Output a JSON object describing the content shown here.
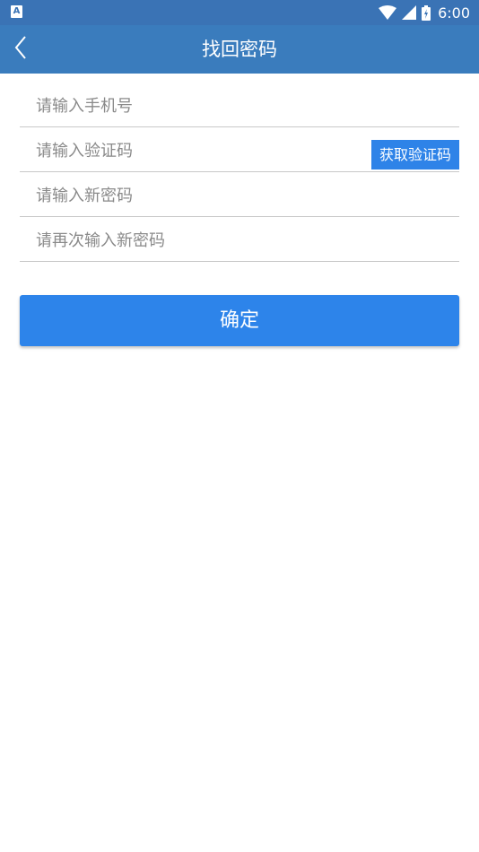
{
  "status_bar": {
    "notification_icon": "A",
    "icons": [
      "wifi-icon",
      "signal-icon",
      "battery-icon"
    ],
    "time": "6:00"
  },
  "app_bar": {
    "back_icon": "chevron-left-icon",
    "title": "找回密码"
  },
  "form": {
    "phone": {
      "placeholder": "请输入手机号",
      "value": ""
    },
    "code": {
      "placeholder": "请输入验证码",
      "value": "",
      "button_label": "获取验证码"
    },
    "new_password": {
      "placeholder": "请输入新密码",
      "value": ""
    },
    "confirm_password": {
      "placeholder": "请再次输入新密码",
      "value": ""
    }
  },
  "confirm_button": {
    "label": "确定"
  },
  "colors": {
    "status_bar": "#3a73b5",
    "app_bar": "#3a7cbd",
    "primary_button": "#2d84ea",
    "divider": "#c8c8c8",
    "placeholder": "#8a8a8a"
  }
}
